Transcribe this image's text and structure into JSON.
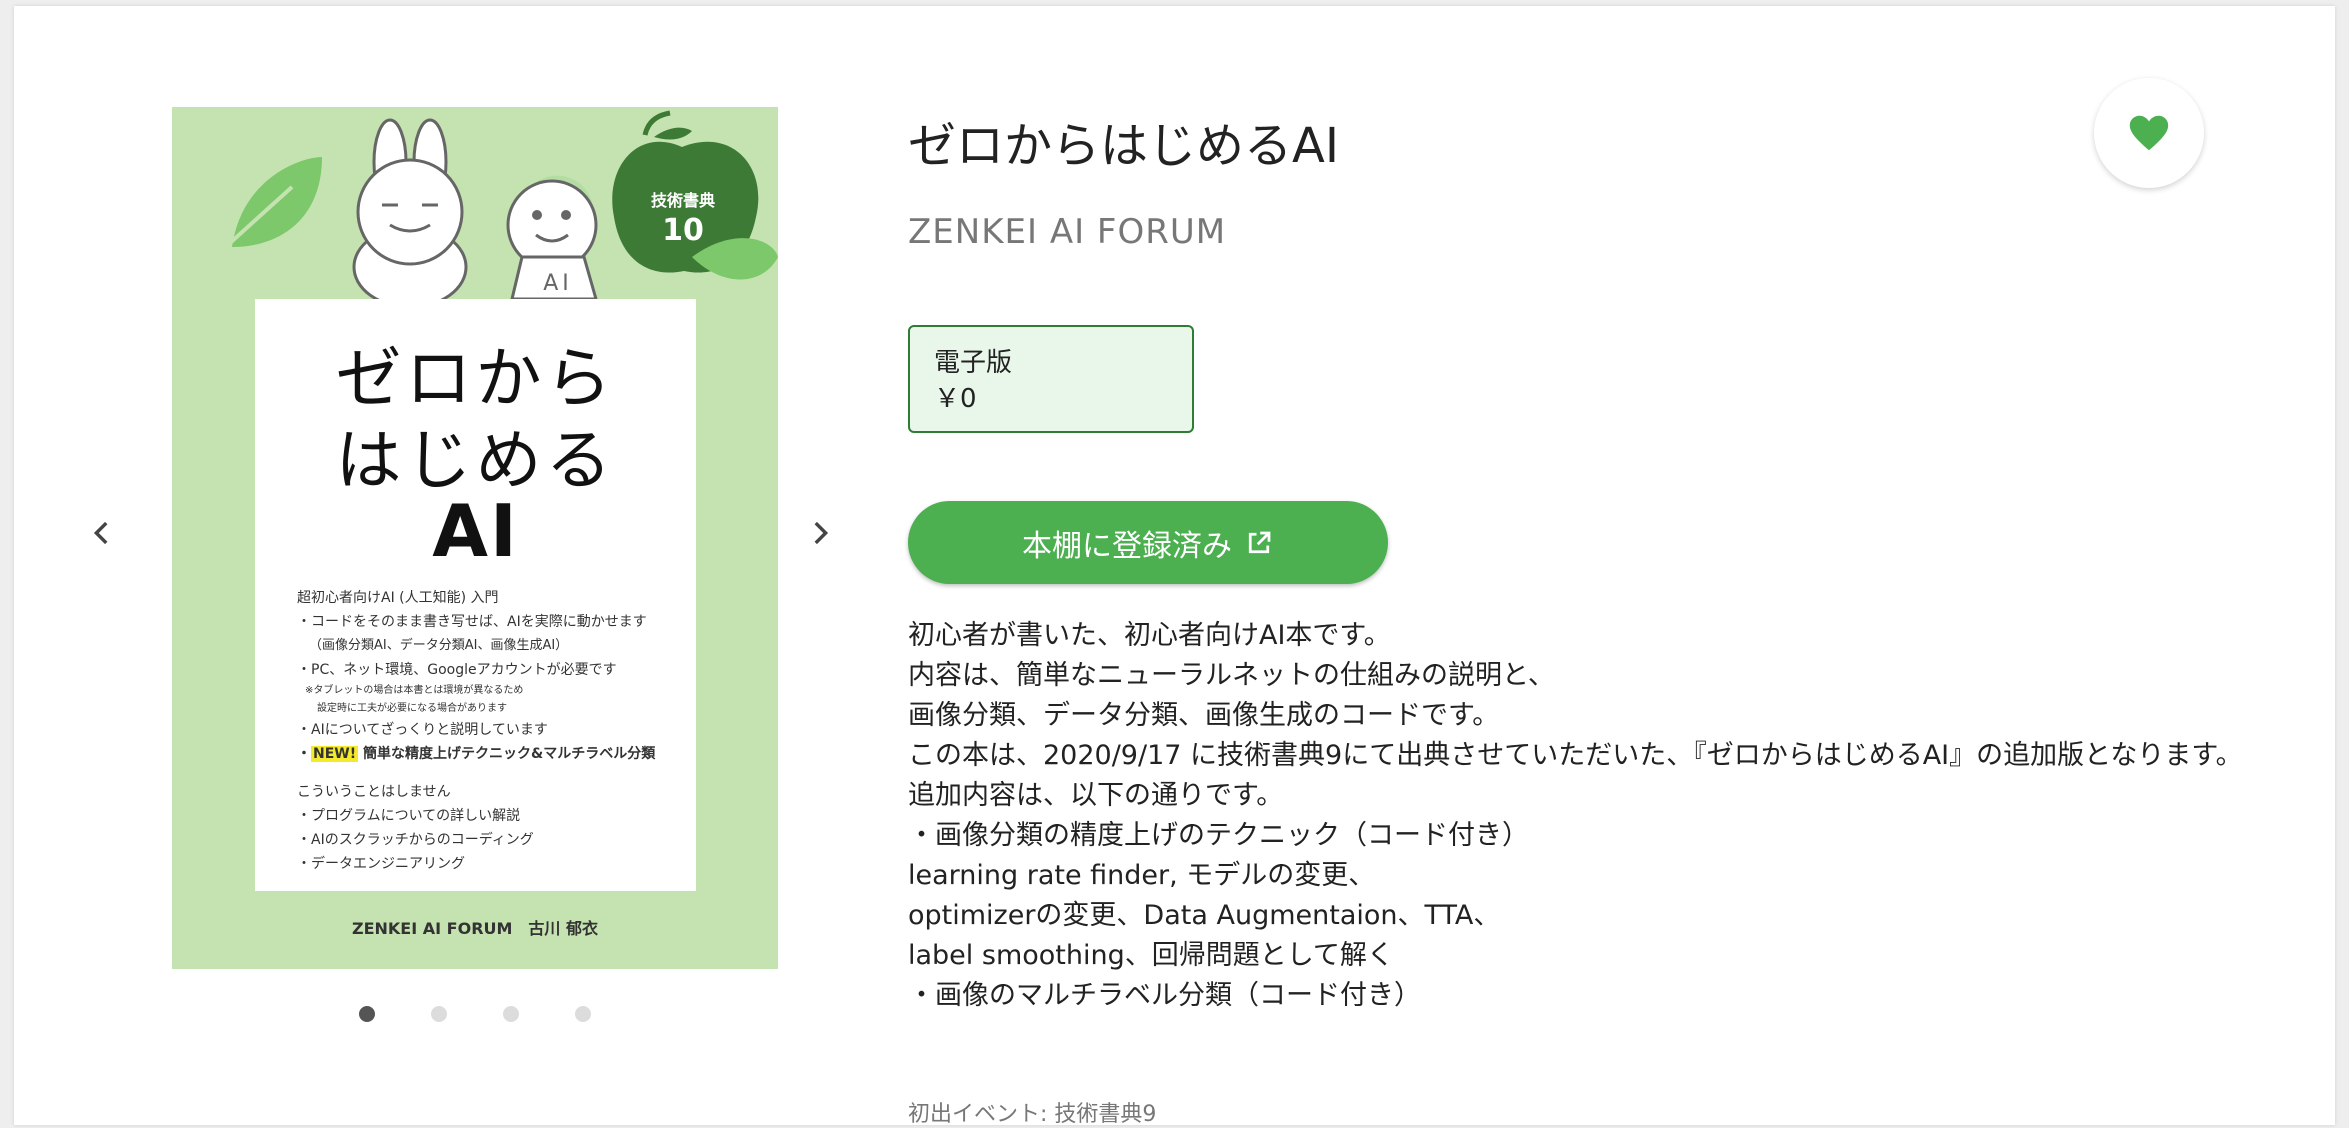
{
  "carousel": {
    "prev_icon": "chevron-left-icon",
    "next_icon": "chevron-right-icon",
    "slide_count": 4,
    "active_slide": 1
  },
  "cover": {
    "badge_line1": "技術書典",
    "badge_line2": "10",
    "face_label": "AI",
    "title_line1": "ゼロから",
    "title_line2": "はじめる",
    "title_line3": "AI",
    "list": [
      "超初心者向けAI (人工知能) 入門",
      "・コードをそのまま書き写せば、AIを実際に動かせます",
      "（画像分類AI、データ分類AI、画像生成AI）",
      "・PC、ネット環境、Googleアカウントが必要です",
      "※タブレットの場合は本書とは環境が異なるため",
      "設定時に工夫が必要になる場合があります",
      "・AIについてざっくりと説明しています",
      "NEW!",
      "簡単な精度上げテクニック&マルチラベル分類",
      "こういうことはしません",
      "・プログラムについての詳しい解説",
      "・AIのスクラッチからのコーディング",
      "・データエンジニアリング"
    ],
    "author": "ZENKEI AI FORUM　古川 郁衣"
  },
  "book": {
    "title": "ゼロからはじめるAI",
    "circle": "ZENKEI AI FORUM",
    "favorite_icon": "heart-icon",
    "favorite_color": "#4caf50",
    "price_label": "電子版",
    "price_value": "￥0",
    "shelf_button_label": "本棚に登録済み",
    "shelf_button_icon": "external-link-icon",
    "accent_color": "#4caf50",
    "description": [
      "初心者が書いた、初心者向けAI本です。",
      "内容は、簡単なニューラルネットの仕組みの説明と、",
      "画像分類、データ分類、画像生成のコードです。",
      "この本は、2020/9/17 に技術書典9にて出典させていただいた、『ゼロからはじめるAI』の追加版となります。",
      "追加内容は、以下の通りです。",
      "・画像分類の精度上げのテクニック（コード付き）",
      "learning rate finder, モデルの変更、",
      "optimizerの変更、Data Augmentaion、TTA、",
      "label smoothing、回帰問題として解く",
      "・画像のマルチラベル分類（コード付き）"
    ],
    "event": "初出イベント: 技術書典9"
  }
}
